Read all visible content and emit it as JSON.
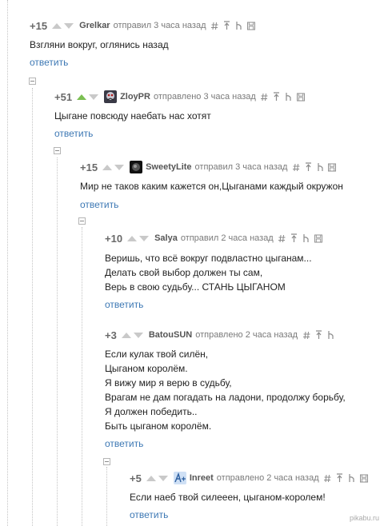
{
  "comments": [
    {
      "rating": "+15",
      "author": "Grelkar",
      "meta": "отправил 3 часа назад",
      "lines": [
        "Взгляни вокруг, оглянись назад"
      ],
      "reply": "ответить"
    },
    {
      "rating": "+51",
      "author": "ZloyPR",
      "meta": "отправлено 3 часа назад",
      "lines": [
        "Цыгане повсюду наебать нас хотят"
      ],
      "reply": "ответить"
    },
    {
      "rating": "+15",
      "author": "SweetyLite",
      "meta": "отправил 3 часа назад",
      "lines": [
        "Мир не таков каким кажется он,Цыганами каждый окружон"
      ],
      "reply": "ответить"
    },
    {
      "rating": "+10",
      "author": "Salya",
      "meta": "отправил 2 часа назад",
      "lines": [
        "Веришь, что всё вокруг подвластно цыганам...",
        "Делать свой выбор должен ты сам,",
        "Верь в свою судьбу... СТАНЬ ЦЫГАНОМ"
      ],
      "reply": "ответить"
    },
    {
      "rating": "+3",
      "author": "BatouSUN",
      "meta": "отправлено 2 часа назад",
      "lines": [
        "Если кулак твой силён,",
        "Цыганом королём.",
        "Я вижу мир я верю в судьбу,",
        "Врагам не дам погадать на ладони, продолжу борьбу,",
        "Я должен победить..",
        "Быть цыганом королём."
      ],
      "reply": "ответить"
    },
    {
      "rating": "+5",
      "author": "Inreet",
      "meta": "отправлено 2 часа назад",
      "lines": [
        "Если наеб твой силееен, цыганом-королем!"
      ],
      "reply": "ответить"
    }
  ],
  "watermark": "pikabu.ru"
}
